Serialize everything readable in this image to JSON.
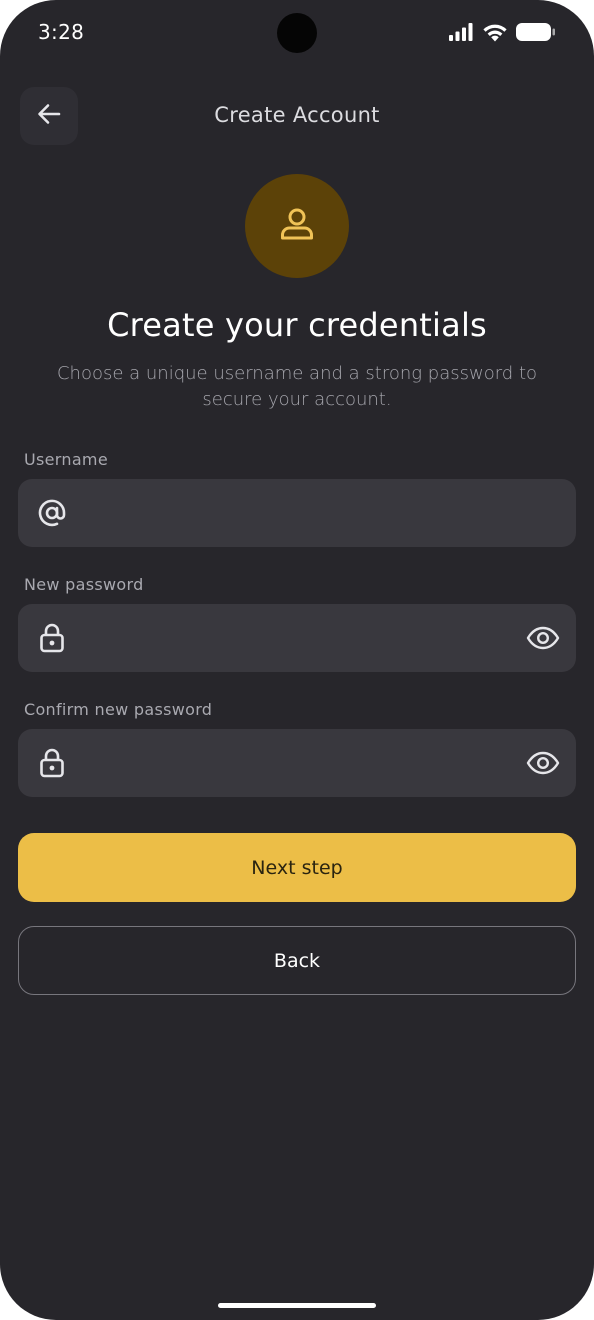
{
  "status_bar": {
    "time": "3:28",
    "icons": [
      "signal-icon",
      "wifi-icon",
      "battery-icon"
    ]
  },
  "header": {
    "title": "Create Account",
    "back_icon": "arrow-left-icon"
  },
  "avatar": {
    "icon": "user-icon",
    "accent_color": "#f0c357",
    "background_color": "#5c4208"
  },
  "main": {
    "heading": "Create your credentials",
    "subtitle": "Choose a unique username and a strong password to secure your account."
  },
  "form": {
    "username": {
      "label": "Username",
      "value": "",
      "placeholder": "",
      "icon": "at-sign-icon"
    },
    "new_password": {
      "label": "New password",
      "value": "",
      "placeholder": "",
      "icon": "lock-icon",
      "toggle_icon": "eye-icon"
    },
    "confirm_password": {
      "label": "Confirm new password",
      "value": "",
      "placeholder": "",
      "icon": "lock-icon",
      "toggle_icon": "eye-icon"
    }
  },
  "actions": {
    "next_label": "Next step",
    "back_label": "Back",
    "primary_color": "#ecbe47"
  },
  "theme": {
    "background": "#27262b",
    "field_background": "#39383e"
  }
}
